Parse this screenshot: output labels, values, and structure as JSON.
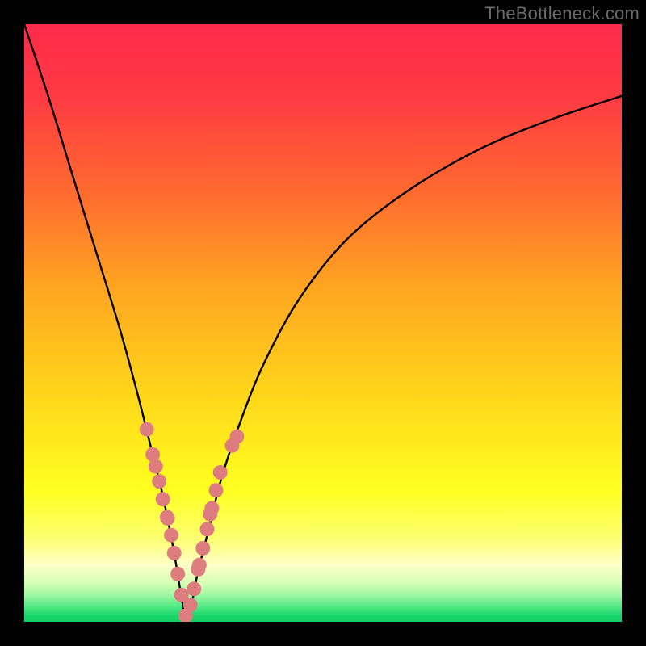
{
  "watermark": {
    "text": "TheBottleneck.com"
  },
  "colors": {
    "frame": "#000000",
    "curve": "#000000",
    "dot_fill": "#de7d7f",
    "gradient_stops": [
      {
        "offset": 0.0,
        "color": "#ff2a4a"
      },
      {
        "offset": 0.12,
        "color": "#ff3a43"
      },
      {
        "offset": 0.28,
        "color": "#ff6a2f"
      },
      {
        "offset": 0.45,
        "color": "#ffa820"
      },
      {
        "offset": 0.62,
        "color": "#ffd61a"
      },
      {
        "offset": 0.78,
        "color": "#ffff20"
      },
      {
        "offset": 0.86,
        "color": "#fcff6e"
      },
      {
        "offset": 0.905,
        "color": "#ffffc8"
      },
      {
        "offset": 0.935,
        "color": "#d6ffb4"
      },
      {
        "offset": 0.958,
        "color": "#96f6a0"
      },
      {
        "offset": 0.975,
        "color": "#4fe882"
      },
      {
        "offset": 0.99,
        "color": "#17d66a"
      },
      {
        "offset": 1.0,
        "color": "#0fcf63"
      }
    ]
  },
  "chart_data": {
    "type": "line",
    "title": "",
    "xlabel": "",
    "ylabel": "",
    "xlim": [
      0,
      100
    ],
    "ylim": [
      0,
      100
    ],
    "note": "V-shaped bottleneck curve; minimum ≈ x=27, y≈0. y roughly = |distance from optimum| scaled nonlinearly.",
    "series": [
      {
        "name": "bottleneck-curve",
        "x": [
          0,
          4,
          8,
          12,
          16,
          19,
          21,
          23,
          25,
          26,
          27,
          28,
          29,
          31,
          33,
          36,
          40,
          46,
          54,
          64,
          76,
          88,
          100
        ],
        "y": [
          100,
          88,
          75,
          62,
          49,
          38,
          30,
          22,
          12,
          6,
          1,
          3,
          8,
          16,
          24,
          33,
          43,
          54,
          64,
          72,
          79,
          84,
          88
        ]
      }
    ],
    "scatter_overlay": {
      "name": "sample-points",
      "color": "#de7d7f",
      "x": [
        20.5,
        21.5,
        22.0,
        22.6,
        23.2,
        23.9,
        24.0,
        24.6,
        25.1,
        25.7,
        26.3,
        27.0,
        27.8,
        28.4,
        29.1,
        29.3,
        29.9,
        30.6,
        31.1,
        31.4,
        32.1,
        32.8,
        34.8,
        35.6
      ],
      "y": [
        32.2,
        28.0,
        26.0,
        23.5,
        20.5,
        17.5,
        17.3,
        14.5,
        11.5,
        8.0,
        4.5,
        1.0,
        2.8,
        5.5,
        8.8,
        9.5,
        12.3,
        15.5,
        18.0,
        19.0,
        22.0,
        25.0,
        29.5,
        31.0
      ]
    }
  }
}
